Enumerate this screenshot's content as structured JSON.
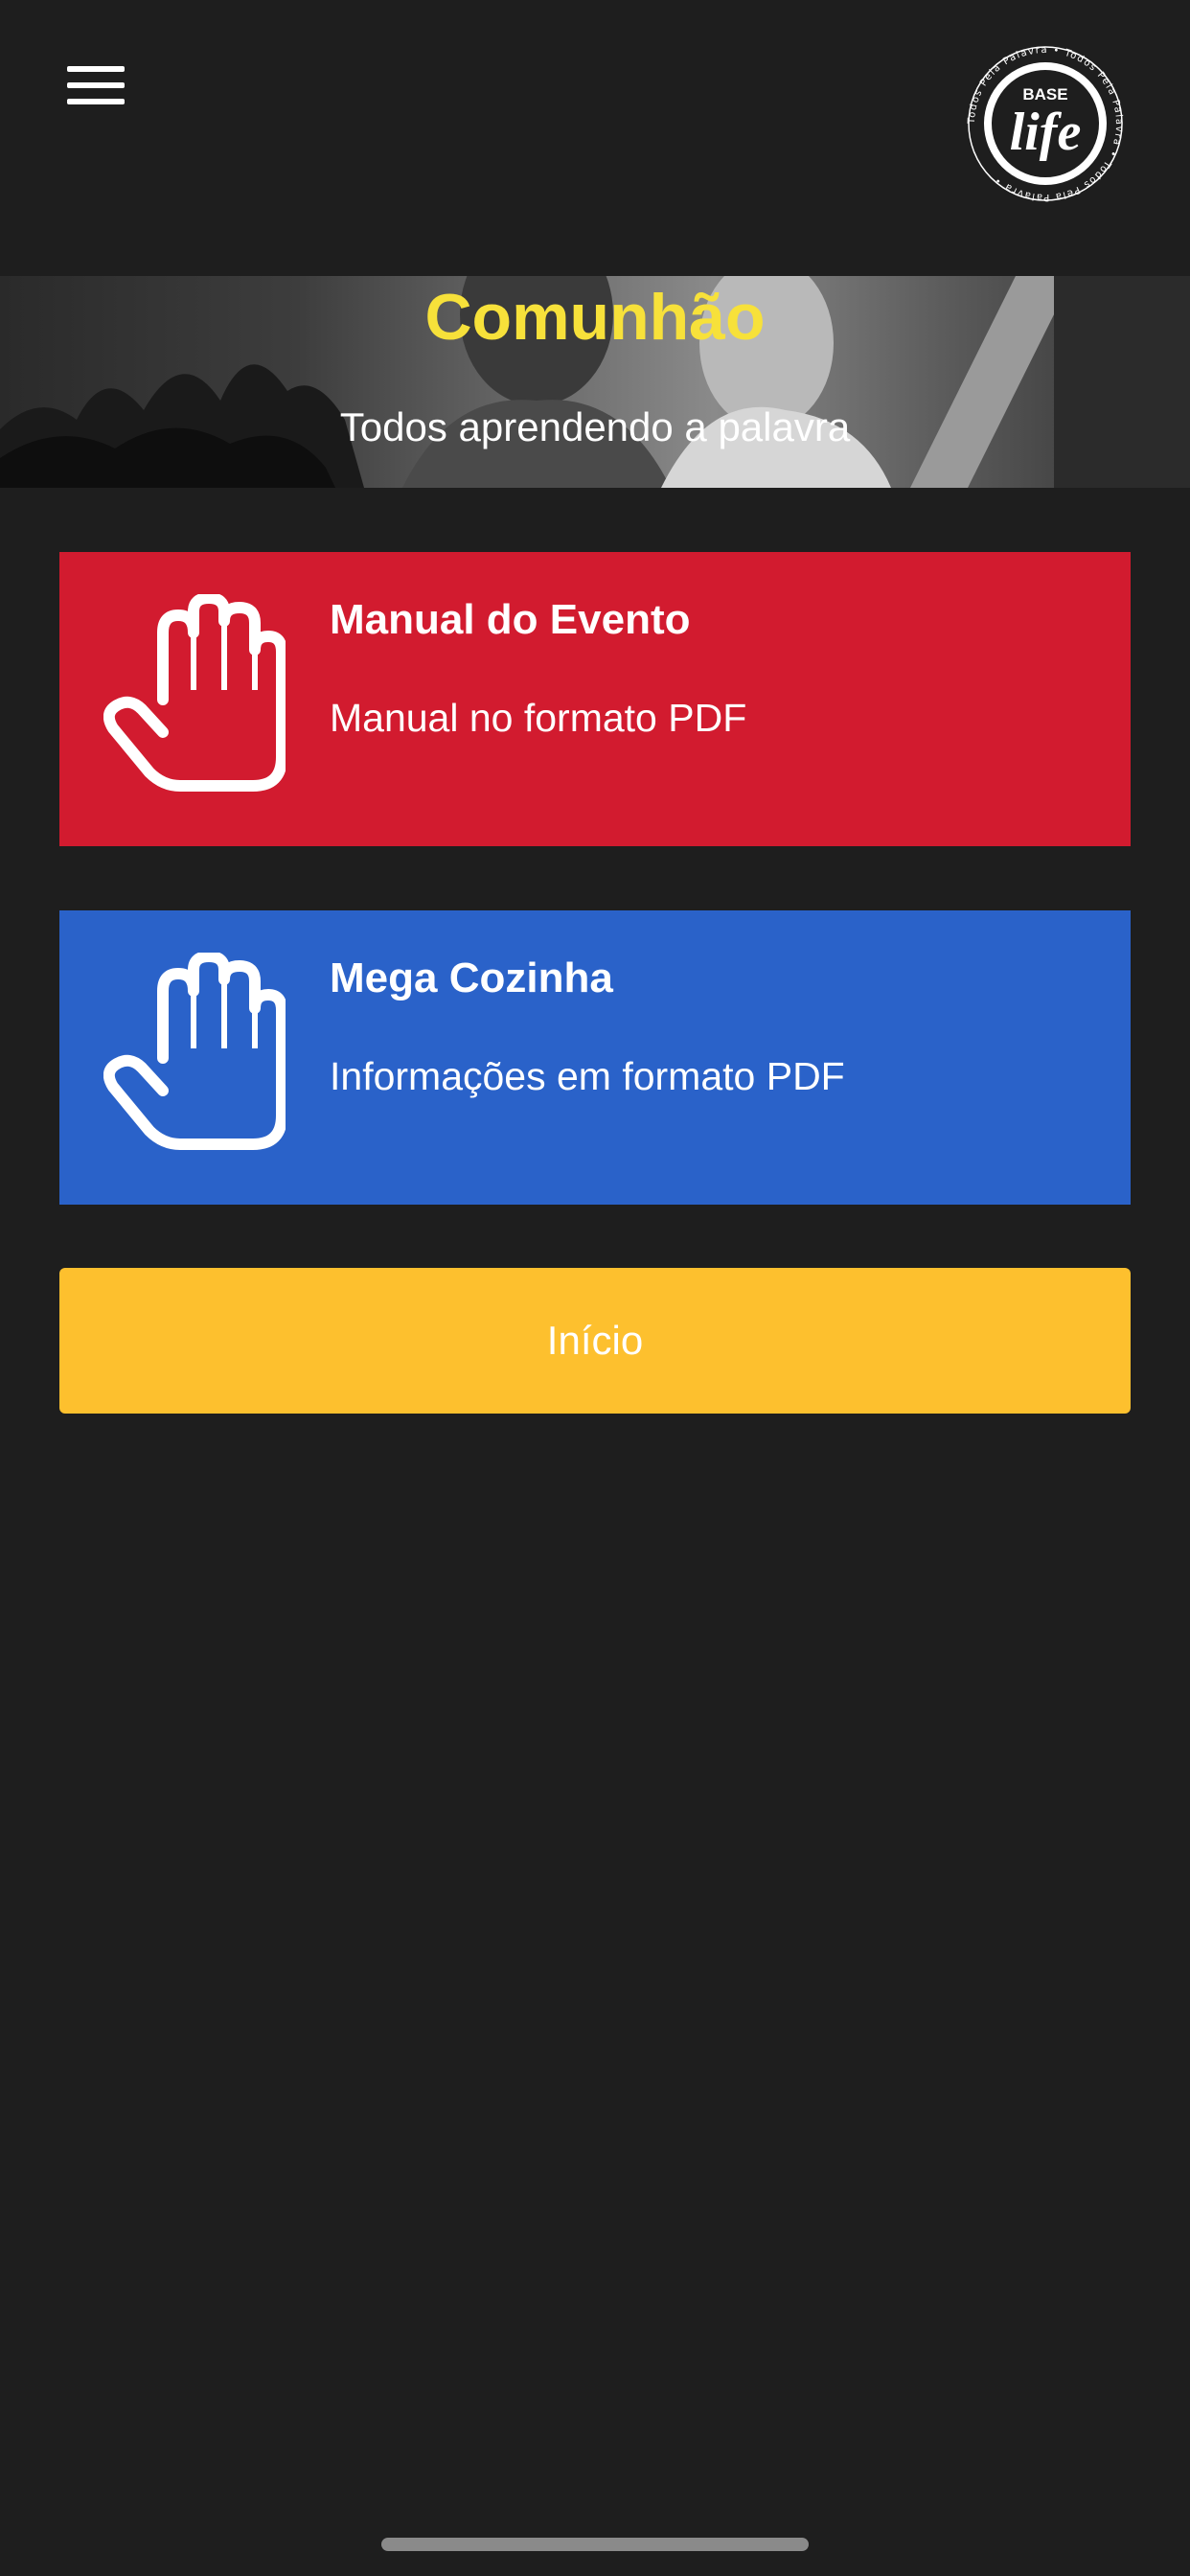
{
  "header": {
    "menu_icon": "hamburger-menu-icon",
    "logo": {
      "top_text": "BASE",
      "main_text": "life",
      "ring_text": "Todos Pela Palavra • Todos Pela Palavra • Todos Pela Palavra •"
    }
  },
  "banner": {
    "title": "Comunhão",
    "subtitle": "Todos aprendendo a palavra"
  },
  "cards": [
    {
      "title": "Manual do Evento",
      "description": "Manual no formato PDF",
      "icon": "hand-icon",
      "color": "#d21b2f"
    },
    {
      "title": "Mega Cozinha",
      "description": "Informações em formato PDF",
      "icon": "hand-icon",
      "color": "#2a62c9"
    }
  ],
  "start_button": {
    "label": "Início",
    "color": "#fdc02e"
  },
  "colors": {
    "background": "#1e1e1e",
    "title_yellow": "#f7e13a"
  }
}
